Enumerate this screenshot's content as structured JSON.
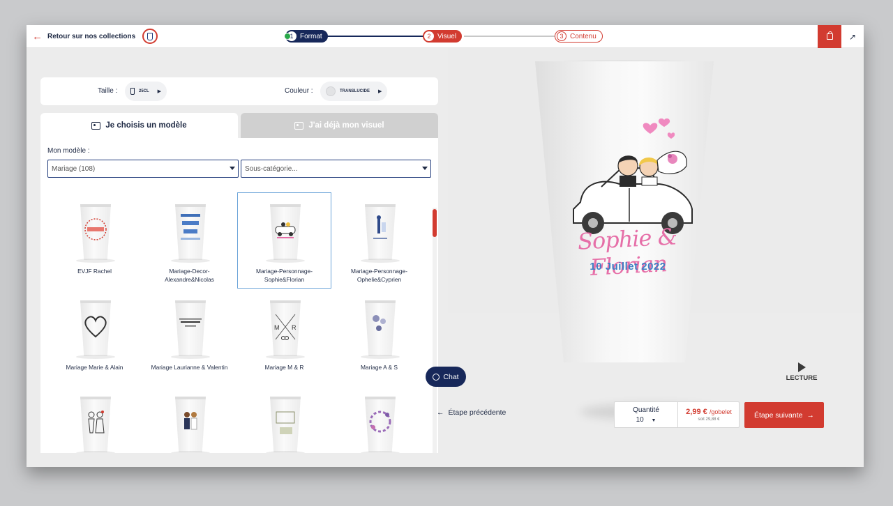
{
  "header": {
    "back_label": "Retour sur nos collections",
    "steps": [
      {
        "num": "1",
        "label": "Format"
      },
      {
        "num": "2",
        "label": "Visuel"
      },
      {
        "num": "3",
        "label": "Contenu"
      }
    ],
    "cart_icon": "bag-icon",
    "share_icon": "share-icon"
  },
  "options": {
    "size_label": "Taille :",
    "size_value": "25CL",
    "color_label": "Couleur :",
    "color_value": "TRANSLUCIDE"
  },
  "tabs": {
    "model": "Je choisis un modèle",
    "visual": "J'ai déjà mon visuel"
  },
  "models": {
    "label": "Mon modèle :",
    "category": "Mariage (108)",
    "subcategory_placeholder": "Sous-catégorie...",
    "items": [
      {
        "title": "EVJF Rachel"
      },
      {
        "title": "Mariage-Decor-Alexandre&Nicolas"
      },
      {
        "title": "Mariage-Personnage-Sophie&Florian"
      },
      {
        "title": "Mariage-Personnage-Ophelie&Cyprien"
      },
      {
        "title": "Mariage Marie & Alain"
      },
      {
        "title": "Mariage Laurianne & Valentin"
      },
      {
        "title": "Mariage M & R"
      },
      {
        "title": "Mariage A & S"
      }
    ]
  },
  "preview": {
    "names": "Sophie & Florian",
    "date": "10 Juillet 2022",
    "play_label": "LECTURE"
  },
  "footer": {
    "chat_label": "Chat",
    "prev_label": "Étape précédente",
    "qty_label": "Quantité",
    "qty_value": "10",
    "price": "2,99 €",
    "price_unit": "/gobelet",
    "price_total": "soit 29,88 €",
    "next_label": "Étape suivante"
  },
  "colors": {
    "accent": "#d23b30",
    "navy": "#17285a",
    "pink": "#e66fa8",
    "blue": "#3f7fc4"
  }
}
